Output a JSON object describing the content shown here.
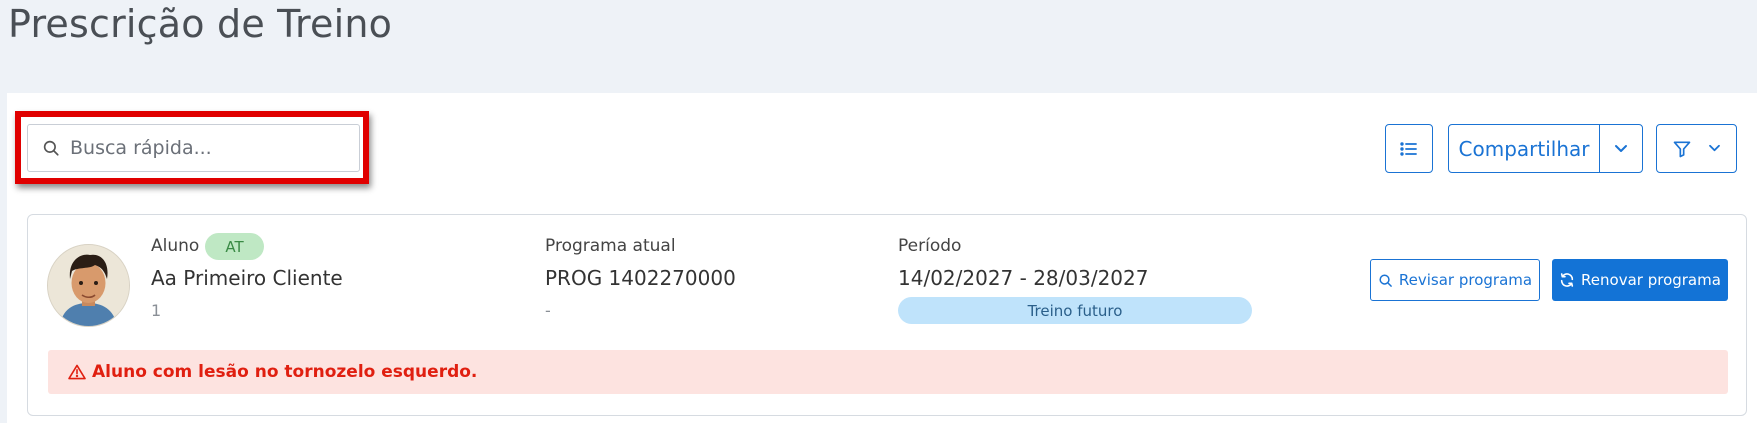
{
  "page": {
    "title": "Prescrição de Treino"
  },
  "search": {
    "placeholder": "Busca rápida..."
  },
  "toolbar": {
    "share_label": "Compartilhar",
    "list_icon": "list-icon",
    "share_dropdown_icon": "chevron-down-icon",
    "filter_icon": "filter-icon"
  },
  "student_card": {
    "student_label": "Aluno",
    "status_badge": "AT",
    "student_name": "Aa Primeiro Cliente",
    "student_id": "1",
    "program_label": "Programa atual",
    "program_name": "PROG 1402270000",
    "program_sub": "-",
    "period_label": "Período",
    "period_value": "14/02/2027 - 28/03/2027",
    "period_status": "Treino futuro",
    "review_button": "Revisar programa",
    "renew_button": "Renovar programa",
    "alert_text": "Aluno com lesão no tornozelo esquerdo."
  },
  "colors": {
    "primary": "#1373d6",
    "highlight_border": "#e00000",
    "alert_bg": "#fde3e0",
    "alert_text": "#e01f10",
    "badge_green_bg": "#bfe8c4",
    "pill_blue_bg": "#bfe3fb"
  }
}
